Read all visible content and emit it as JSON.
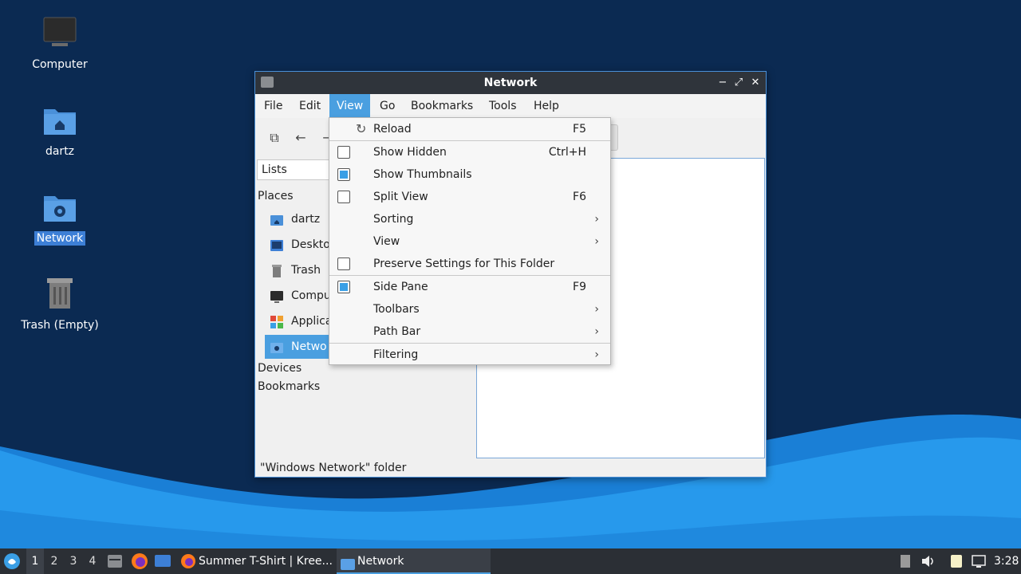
{
  "desktop": {
    "icons": [
      {
        "label": "Computer"
      },
      {
        "label": "dartz"
      },
      {
        "label": "Network"
      },
      {
        "label": "Trash (Empty)"
      }
    ]
  },
  "window": {
    "title": "Network",
    "menubar": [
      "File",
      "Edit",
      "View",
      "Go",
      "Bookmarks",
      "Tools",
      "Help"
    ],
    "active_menu": "View",
    "side_pane": {
      "mode": "Lists",
      "places_header": "Places",
      "places": [
        "dartz",
        "Deskto",
        "Trash",
        "Compu",
        "Applica",
        "Netwo"
      ],
      "devices_header": "Devices",
      "bookmarks_header": "Bookmarks"
    },
    "status": "\"Windows Network\" folder"
  },
  "view_menu": {
    "reload": {
      "label": "Reload",
      "accel": "F5"
    },
    "show_hidden": {
      "label": "Show Hidden",
      "accel": "Ctrl+H",
      "checked": false
    },
    "show_thumbnails": {
      "label": "Show Thumbnails",
      "checked": true
    },
    "split_view": {
      "label": "Split View",
      "accel": "F6",
      "checked": false
    },
    "sorting": {
      "label": "Sorting"
    },
    "view": {
      "label": "View"
    },
    "preserve": {
      "label": "Preserve Settings for This Folder",
      "checked": false
    },
    "side_pane": {
      "label": "Side Pane",
      "accel": "F9",
      "checked": true
    },
    "toolbars": {
      "label": "Toolbars"
    },
    "path_bar": {
      "label": "Path Bar"
    },
    "filtering": {
      "label": "Filtering"
    }
  },
  "taskbar": {
    "workspaces": [
      "1",
      "2",
      "3",
      "4"
    ],
    "tasks": [
      {
        "label": "Summer T-Shirt | Kree..."
      },
      {
        "label": "Network"
      }
    ],
    "clock": "3:28"
  },
  "colors": {
    "accent": "#4a9fe0",
    "wallpaper_dark": "#0b2a52",
    "wallpaper_wave": "#1f8fe8"
  }
}
